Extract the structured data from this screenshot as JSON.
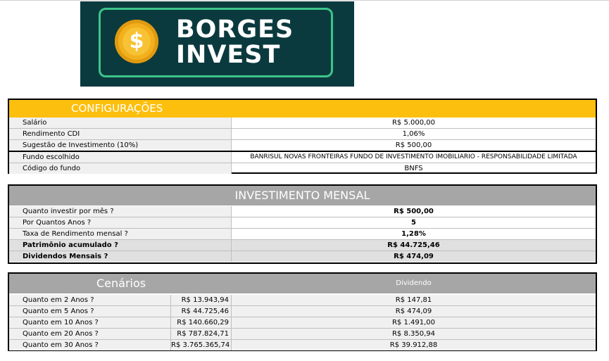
{
  "logo": {
    "coin_symbol": "$",
    "line1": "BORGES",
    "line2": "INVEST"
  },
  "config": {
    "title": "CONFIGURAÇÕES",
    "rows": [
      {
        "label": "Salário",
        "value": "R$ 5.000,00"
      },
      {
        "label": "Rendimento CDI",
        "value": "1,06%"
      },
      {
        "label": "Sugestão de Investimento (10%)",
        "value": "R$ 500,00"
      },
      {
        "label": "Fundo escolhido",
        "value": "BANRISUL NOVAS FRONTEIRAS FUNDO DE INVESTIMENTO IMOBILIARIO - RESPONSABILIDADE LIMITADA"
      },
      {
        "label": "Código do fundo",
        "value": "BNFS"
      }
    ]
  },
  "monthly": {
    "title": "INVESTIMENTO MENSAL",
    "rows": [
      {
        "label": "Quanto investir por mês ?",
        "value": "R$ 500,00"
      },
      {
        "label": "Por Quantos Anos ?",
        "value": "5"
      },
      {
        "label": "Taxa de Rendimento mensal ?",
        "value": "1,28%"
      },
      {
        "label": "Patrimônio acumulado ?",
        "value": "R$ 44.725,46"
      },
      {
        "label": "Dividendos Mensais ?",
        "value": "R$ 474,09"
      }
    ]
  },
  "scenarios": {
    "title": "Cenários",
    "dividend_header": "Dividendo",
    "rows": [
      {
        "label": "Quanto em 2 Anos ?",
        "value": "R$ 13.943,94",
        "dividend": "R$ 147,81"
      },
      {
        "label": "Quanto em 5 Anos ?",
        "value": "R$ 44.725,46",
        "dividend": "R$ 474,09"
      },
      {
        "label": "Quanto em 10 Anos ?",
        "value": "R$ 140.660,29",
        "dividend": "R$ 1.491,00"
      },
      {
        "label": "Quanto em 20 Anos ?",
        "value": "R$ 787.824,71",
        "dividend": "R$ 8.350,94"
      },
      {
        "label": "Quanto em 30 Anos ?",
        "value": "R$ 3.765.365,74",
        "dividend": "R$ 39.912,88"
      }
    ]
  },
  "colors": {
    "config_header": "#fdbf0d",
    "section_header": "#a6a6a6",
    "logo_bg": "#0b3a3e",
    "logo_frame": "#3ec48a",
    "coin": "#f2b01e"
  }
}
